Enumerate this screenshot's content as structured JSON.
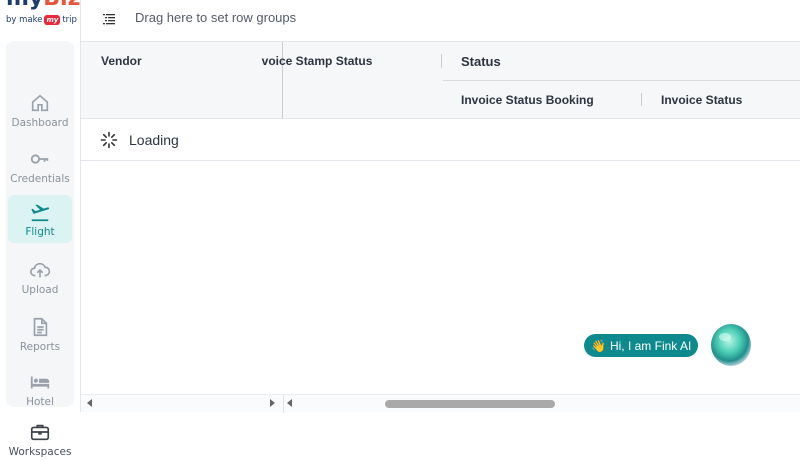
{
  "logo": {
    "brand": "Biz",
    "by": "by make",
    "mmt": "my",
    "trip": "trip"
  },
  "sidebar": {
    "items": [
      {
        "label": "Dashboard",
        "icon": "home-icon",
        "active": false
      },
      {
        "label": "Credentials",
        "icon": "key-icon",
        "active": false
      },
      {
        "label": "Flight",
        "icon": "flight-takeoff-icon",
        "active": true
      },
      {
        "label": "Upload",
        "icon": "cloud-upload-icon",
        "active": false
      },
      {
        "label": "Reports",
        "icon": "document-icon",
        "active": false
      },
      {
        "label": "Hotel",
        "icon": "bed-icon",
        "active": false
      }
    ],
    "workspaces": {
      "label": "Workspaces",
      "icon": "briefcase-icon"
    }
  },
  "grid": {
    "row_group_placeholder": "Drag here to set row groups",
    "columns": {
      "vendor": "Vendor",
      "invoice_stamp_status": "Invoice Stamp Status",
      "status_group": "Status",
      "invoice_status_booking": "Invoice Status Booking",
      "invoice_status": "Invoice Status"
    },
    "loading_text": "Loading"
  },
  "assistant": {
    "wave": "👋",
    "greeting": "Hi, I am Fink AI"
  },
  "colors": {
    "accent": "#0e8a8e",
    "active_bg": "#dcf3f3",
    "header_bg": "#f6f7f9"
  }
}
